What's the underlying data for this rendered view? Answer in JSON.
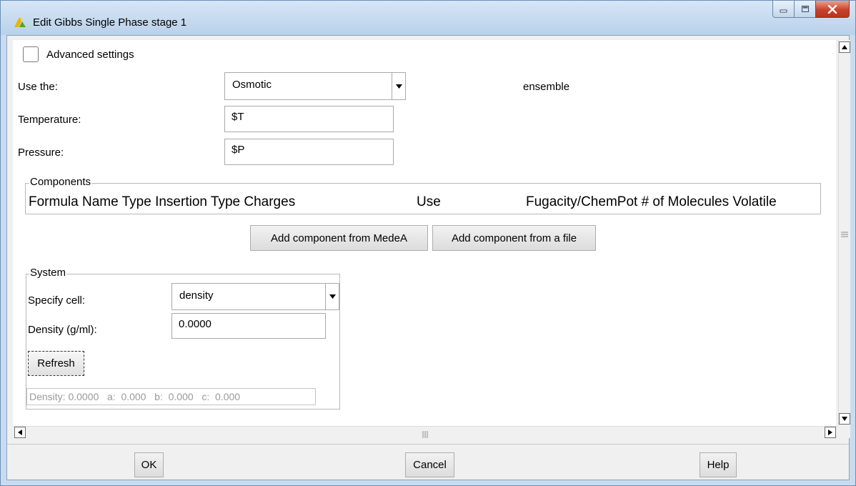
{
  "window": {
    "title": "Edit Gibbs Single Phase stage 1"
  },
  "advanced": {
    "label": "Advanced settings",
    "checked": false
  },
  "ensemble": {
    "label": "Use the:",
    "value": "Osmotic",
    "suffix": "ensemble"
  },
  "temperature": {
    "label": "Temperature:",
    "value": "$T"
  },
  "pressure": {
    "label": "Pressure:",
    "value": "$P"
  },
  "components": {
    "legend": "Components",
    "columns": [
      "Formula",
      "Name",
      "Type",
      "Insertion Type",
      "Charges",
      "Use",
      "Fugacity/ChemPot",
      "# of Molecules",
      "Volatile"
    ],
    "add_medea_label": "Add component from MedeA",
    "add_file_label": "Add component from a file"
  },
  "system": {
    "legend": "System",
    "specify_label": "Specify cell:",
    "specify_value": "density",
    "density_label": "Density (g/ml):",
    "density_value": "0.0000",
    "refresh_label": "Refresh",
    "summary": {
      "density_label": "Density:",
      "density": "0.0000",
      "a_label": "a:",
      "a": "0.000",
      "b_label": "b:",
      "b": "0.000",
      "c_label": "c:",
      "c": "0.000"
    }
  },
  "footer": {
    "ok_label": "OK",
    "cancel_label": "Cancel",
    "help_label": "Help"
  },
  "icons": {
    "app": "medea-app-icon",
    "minimize": "minimize-icon",
    "maximize": "maximize-icon",
    "close": "close-icon",
    "dropdown": "chevron-down-icon"
  },
  "colors": {
    "titlebar": "#c9dcef",
    "close_button": "#c7432d",
    "app_icon": "#e6b800",
    "disabled_text": "#9a9a9a"
  }
}
